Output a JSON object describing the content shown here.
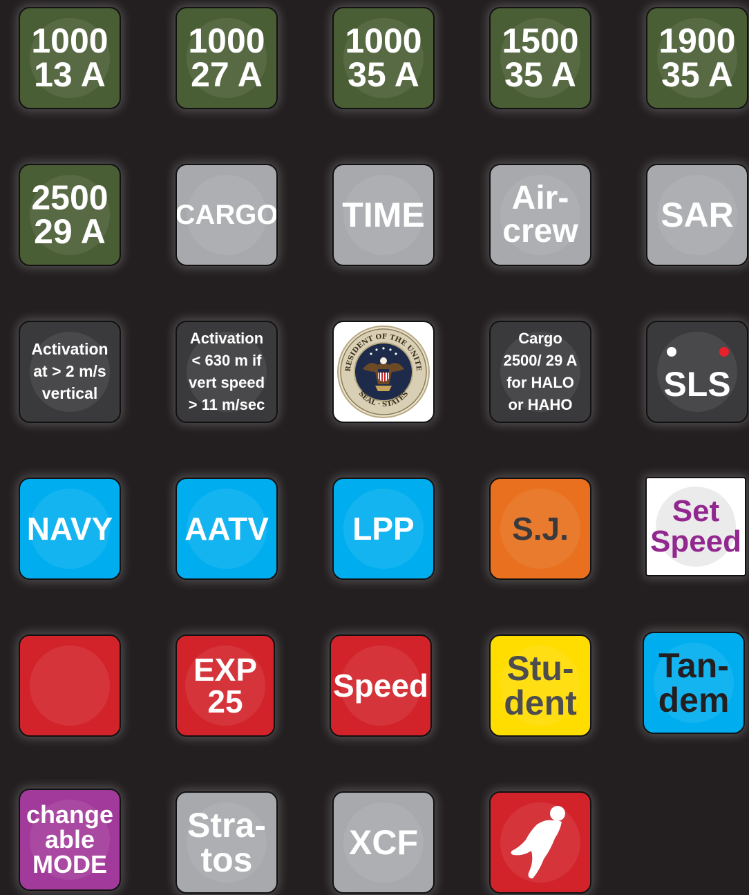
{
  "buttons": {
    "b1000_13": "1000\n13 A",
    "b1000_27": "1000\n27 A",
    "b1000_35": "1000\n35 A",
    "b1500_35": "1500\n35 A",
    "b1900_35": "1900\n35 A",
    "b2500_29": "2500\n29 A",
    "cargo": "CARGO",
    "time": "TIME",
    "aircrew": "Air-\ncrew",
    "sar": "SAR",
    "activation_2ms": "Activation\nat > 2 m/s\nvertical",
    "activation_630": "Activation\n< 630 m if\nvert speed\n> 11 m/sec",
    "seal_text_top": "PRESIDENT OF THE UNITED",
    "seal_text_bottom": "SEAL · STATES",
    "cargo_halo": "Cargo\n2500/ 29 A\nfor HALO\nor HAHO",
    "sls": "SLS",
    "navy": "NAVY",
    "aatv": "AATV",
    "lpp": "LPP",
    "sj": "S.J.",
    "set_speed": "Set\nSpeed",
    "red_blank": "",
    "exp25": "EXP\n25",
    "speed": "Speed",
    "student": "Stu-\ndent",
    "tandem": "Tan-\ndem",
    "changeable_mode": "change\nable\nMODE",
    "stratos": "Stra-\ntos",
    "xcf": "XCF"
  },
  "icons": {
    "seal": "presidential-seal-icon",
    "wingsuit": "wingsuit-icon"
  },
  "colors": {
    "background": "#231f20",
    "green": "#4a5e35",
    "grey": "#a7a9ac",
    "dark": "#3a3a3c",
    "blue": "#00aeef",
    "orange": "#e8701e",
    "red": "#d2232a",
    "yellow": "#ffdd00",
    "purple": "#a23a9b",
    "set_speed_text": "#92278f"
  }
}
